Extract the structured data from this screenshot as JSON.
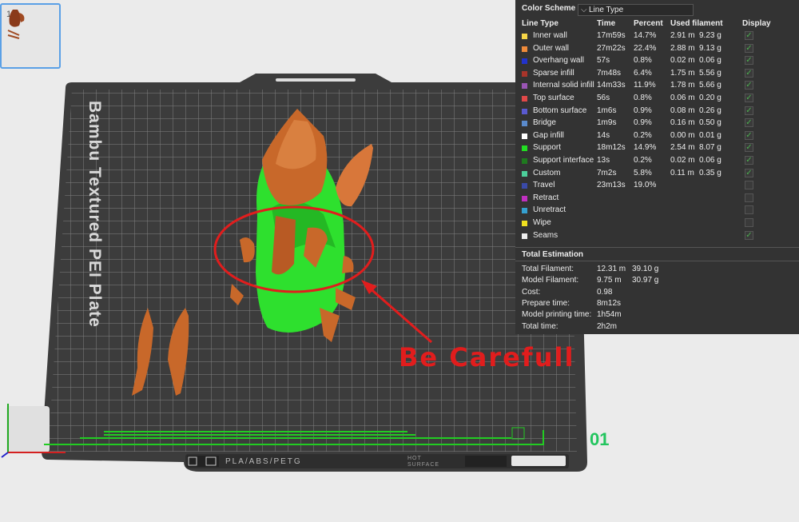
{
  "thumbnail": {
    "number": "1"
  },
  "plate": {
    "title": "Bambu Textured PEI Plate",
    "bed_label": "PLA/ABS/PETG",
    "hot_label_1": "HOT",
    "hot_label_2": "SURFACE",
    "plate_number": "01"
  },
  "annotation": {
    "warning_text": "Be Carefull"
  },
  "legend": {
    "color_scheme_label": "Color Scheme",
    "color_scheme_value": "Line Type",
    "headers": {
      "line_type": "Line Type",
      "time": "Time",
      "percent": "Percent",
      "used_filament": "Used filament",
      "display": "Display"
    },
    "rows": [
      {
        "name": "Inner wall",
        "color": "#f5d547",
        "time": "17m59s",
        "percent": "14.7%",
        "meters": "2.91 m",
        "grams": "9.23 g",
        "display": true
      },
      {
        "name": "Outer wall",
        "color": "#ee8a3a",
        "time": "27m22s",
        "percent": "22.4%",
        "meters": "2.88 m",
        "grams": "9.13 g",
        "display": true
      },
      {
        "name": "Overhang wall",
        "color": "#2233cc",
        "time": "57s",
        "percent": "0.8%",
        "meters": "0.02 m",
        "grams": "0.06 g",
        "display": true
      },
      {
        "name": "Sparse infill",
        "color": "#a8342a",
        "time": "7m48s",
        "percent": "6.4%",
        "meters": "1.75 m",
        "grams": "5.56 g",
        "display": true
      },
      {
        "name": "Internal solid infill",
        "color": "#9a55b5",
        "time": "14m33s",
        "percent": "11.9%",
        "meters": "1.78 m",
        "grams": "5.66 g",
        "display": true
      },
      {
        "name": "Top surface",
        "color": "#e04848",
        "time": "56s",
        "percent": "0.8%",
        "meters": "0.06 m",
        "grams": "0.20 g",
        "display": true
      },
      {
        "name": "Bottom surface",
        "color": "#5a5ad0",
        "time": "1m6s",
        "percent": "0.9%",
        "meters": "0.08 m",
        "grams": "0.26 g",
        "display": true
      },
      {
        "name": "Bridge",
        "color": "#5a8acc",
        "time": "1m9s",
        "percent": "0.9%",
        "meters": "0.16 m",
        "grams": "0.50 g",
        "display": true
      },
      {
        "name": "Gap infill",
        "color": "#ffffff",
        "time": "14s",
        "percent": "0.2%",
        "meters": "0.00 m",
        "grams": "0.01 g",
        "display": true
      },
      {
        "name": "Support",
        "color": "#22dd22",
        "time": "18m12s",
        "percent": "14.9%",
        "meters": "2.54 m",
        "grams": "8.07 g",
        "display": true
      },
      {
        "name": "Support interface",
        "color": "#1f7a1f",
        "time": "13s",
        "percent": "0.2%",
        "meters": "0.02 m",
        "grams": "0.06 g",
        "display": true
      },
      {
        "name": "Custom",
        "color": "#4ccf9a",
        "time": "7m2s",
        "percent": "5.8%",
        "meters": "0.11 m",
        "grams": "0.35 g",
        "display": true
      },
      {
        "name": "Travel",
        "color": "#3a4aa8",
        "time": "23m13s",
        "percent": "19.0%",
        "meters": "",
        "grams": "",
        "display": false
      },
      {
        "name": "Retract",
        "color": "#c030c0",
        "time": "",
        "percent": "",
        "meters": "",
        "grams": "",
        "display": false
      },
      {
        "name": "Unretract",
        "color": "#35a0d0",
        "time": "",
        "percent": "",
        "meters": "",
        "grams": "",
        "display": false
      },
      {
        "name": "Wipe",
        "color": "#f0e020",
        "time": "",
        "percent": "",
        "meters": "",
        "grams": "",
        "display": false
      },
      {
        "name": "Seams",
        "color": "#eeeeee",
        "time": "",
        "percent": "",
        "meters": "",
        "grams": "",
        "display": true
      }
    ]
  },
  "total_estimation": {
    "title": "Total Estimation",
    "rows": [
      {
        "label": "Total Filament:",
        "value1": "12.31 m",
        "value2": "39.10 g"
      },
      {
        "label": "Model Filament:",
        "value1": "9.75 m",
        "value2": "30.97 g"
      },
      {
        "label": "Cost:",
        "value1": "0.98",
        "value2": ""
      },
      {
        "label": "Prepare time:",
        "value1": "8m12s",
        "value2": ""
      },
      {
        "label": "Model printing time:",
        "value1": "1h54m",
        "value2": ""
      },
      {
        "label": "Total time:",
        "value1": "2h2m",
        "value2": ""
      }
    ]
  },
  "colors": {
    "accent": "#5aa0e6",
    "warning": "#e11d1d",
    "support": "#22dd22",
    "model": "#c8682a",
    "plate_number": "#22c55e"
  }
}
